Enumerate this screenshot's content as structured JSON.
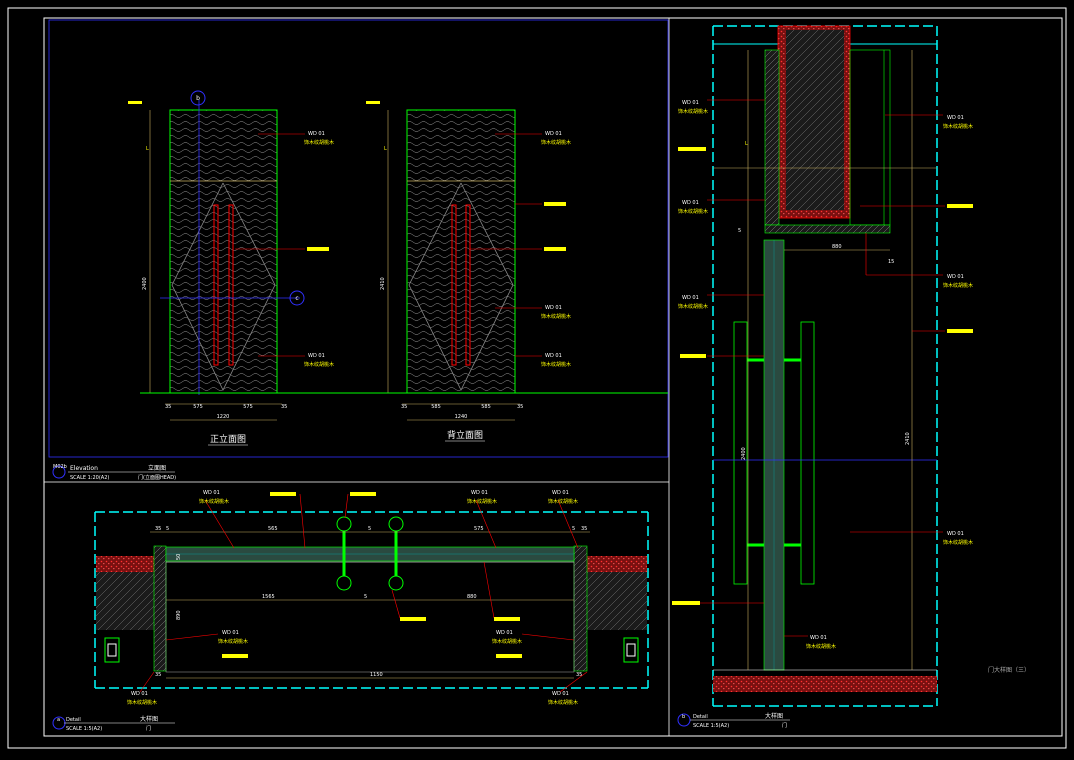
{
  "elevation": {
    "front": {
      "marker_top": "b",
      "marker_mid": "c",
      "height_label": "2400",
      "width_total": "1220",
      "width_left": "575",
      "width_right": "575",
      "edge_left": "35",
      "edge_right": "35",
      "label_L": "L",
      "title": "正立面图"
    },
    "back": {
      "height_label": "2410",
      "width_total": "1240",
      "width_left": "585",
      "width_right": "585",
      "edge_left": "35",
      "edge_right": "35",
      "label_L": "L",
      "title": "背立面图"
    },
    "tags": [
      {
        "code": "WD 01",
        "desc": "饰木纹胡桃木"
      },
      {
        "code": "WD 01",
        "desc": "饰木纹胡桃木"
      },
      {
        "code": "WD 01",
        "desc": "饰木纹胡桃木"
      },
      {
        "code": "WD 01",
        "desc": "饰木纹胡桃木"
      }
    ],
    "caption": {
      "number": "M02b",
      "name": "Elevation",
      "scale": "SCALE 1:20(A2)",
      "cn": "立面图",
      "sub": "门(立面图HEAD)"
    }
  },
  "detail_plan": {
    "dims_top": [
      "35",
      "5",
      "565",
      "5",
      "575",
      "5",
      "35"
    ],
    "dim_center": "5",
    "dims_inner": [
      "1565",
      "5",
      "880"
    ],
    "dim_bottom": "1150",
    "edge_dims": [
      "35",
      "35"
    ],
    "height_left": "890",
    "height_right": "50",
    "tags": [
      {
        "code": "WD 01",
        "desc": "饰木纹胡桃木"
      },
      {
        "code": "WD 01",
        "desc": "饰木纹胡桃木"
      },
      {
        "code": "WD 01",
        "desc": "饰木纹胡桃木"
      },
      {
        "code": "WD 01",
        "desc": "饰木纹胡桃木"
      },
      {
        "code": "WD 01",
        "desc": "饰木纹胡桃木"
      },
      {
        "code": "WD 01",
        "desc": "饰木纹胡桃木"
      }
    ],
    "caption": {
      "letter": "a",
      "name": "Detail",
      "scale": "SCALE 1:5(A2)",
      "cn": "大样图",
      "sub": "门"
    }
  },
  "detail_section": {
    "height_upper": "L",
    "height_lower": "2400",
    "height_right": "2410",
    "dim_mid": "880",
    "dim_15": "15",
    "dim_5": "5",
    "tags": [
      {
        "code": "WD 01",
        "desc": "饰木纹胡桃木"
      },
      {
        "code": "WD 01",
        "desc": "饰木纹胡桃木"
      },
      {
        "code": "WD 01",
        "desc": "饰木纹胡桃木"
      },
      {
        "code": "WD 01",
        "desc": "饰木纹胡桃木"
      },
      {
        "code": "WD 01",
        "desc": "饰木纹胡桃木"
      },
      {
        "code": "WD 01",
        "desc": "饰木纹胡桃木"
      },
      {
        "code": "WD 01",
        "desc": "饰木纹胡桃木"
      }
    ],
    "caption": {
      "letter": "b",
      "name": "Detail",
      "scale": "SCALE 1:5(A2)",
      "cn": "大样图",
      "sub": "门"
    }
  },
  "sheet_title": "门大样图（三）",
  "colors": {
    "frame": "#ffffff",
    "door_outline": "#00ff00",
    "handle": "#ff0000",
    "axis": "#0000ff",
    "dimension": "#ffff00",
    "section": "#00ffff",
    "hatch_red": "#ff0000"
  }
}
